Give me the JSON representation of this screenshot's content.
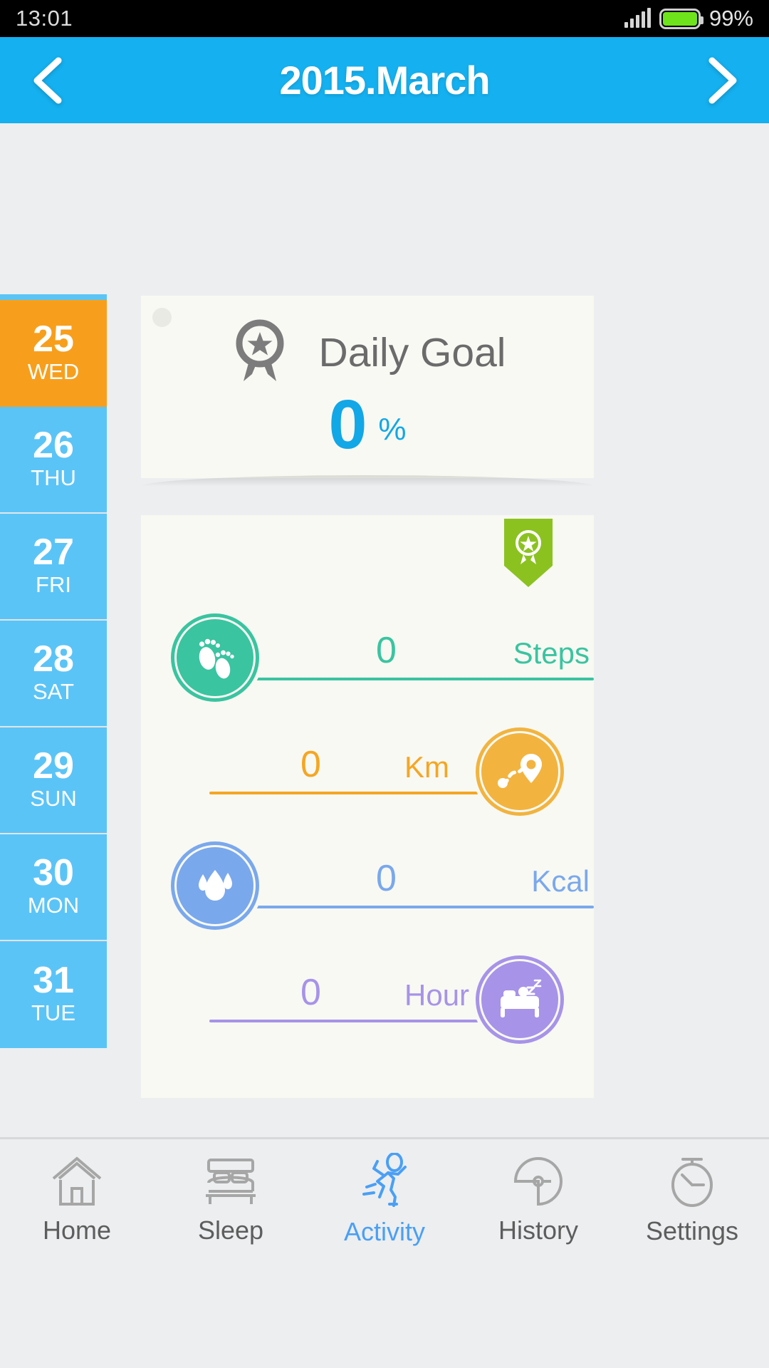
{
  "statusbar": {
    "time": "13:01",
    "battery_pct": "99%",
    "signal_icon": "signal-bars-icon",
    "battery_icon": "battery-icon"
  },
  "header": {
    "title": "2015.March",
    "prev_icon": "chevron-left-icon",
    "next_icon": "chevron-right-icon",
    "accent": "#15b0ef"
  },
  "date_rail": {
    "selected_color": "#f79f1c",
    "default_color": "#5bc4f7",
    "days": [
      {
        "num": "25",
        "dow": "WED",
        "selected": true
      },
      {
        "num": "26",
        "dow": "THU",
        "selected": false
      },
      {
        "num": "27",
        "dow": "FRI",
        "selected": false
      },
      {
        "num": "28",
        "dow": "SAT",
        "selected": false
      },
      {
        "num": "29",
        "dow": "SUN",
        "selected": false
      },
      {
        "num": "30",
        "dow": "MON",
        "selected": false
      },
      {
        "num": "31",
        "dow": "TUE",
        "selected": false
      }
    ]
  },
  "daily_goal": {
    "label": "Daily Goal",
    "value": "0",
    "unit": "%",
    "color": "#12a7e6",
    "medal_icon": "medal-star-icon",
    "dot_icon": "dot-indicator"
  },
  "metrics": {
    "badge_icon": "award-ribbon-badge-icon",
    "badge_color": "#8cc220",
    "rows": [
      {
        "value": "0",
        "unit": "Steps",
        "color": "#3ac4a0",
        "icon": "footprints-icon",
        "icon_side": "left"
      },
      {
        "value": "0",
        "unit": "Km",
        "color": "#f5a623",
        "icon": "route-pin-icon",
        "icon_side": "right"
      },
      {
        "value": "0",
        "unit": "Kcal",
        "color": "#7aa8ec",
        "icon": "flame-drop-icon",
        "icon_side": "left"
      },
      {
        "value": "0",
        "unit": "Hour",
        "color": "#a793e8",
        "icon": "bed-sleep-icon",
        "icon_side": "right"
      }
    ]
  },
  "tabbar": {
    "active_color": "#4a9ff5",
    "inactive_color": "#9a9a9a",
    "items": [
      {
        "label": "Home",
        "icon": "home-icon",
        "active": false
      },
      {
        "label": "Sleep",
        "icon": "bed-icon",
        "active": false
      },
      {
        "label": "Activity",
        "icon": "running-icon",
        "active": true
      },
      {
        "label": "History",
        "icon": "pie-chart-icon",
        "active": false
      },
      {
        "label": "Settings",
        "icon": "stopwatch-icon",
        "active": false
      }
    ]
  }
}
